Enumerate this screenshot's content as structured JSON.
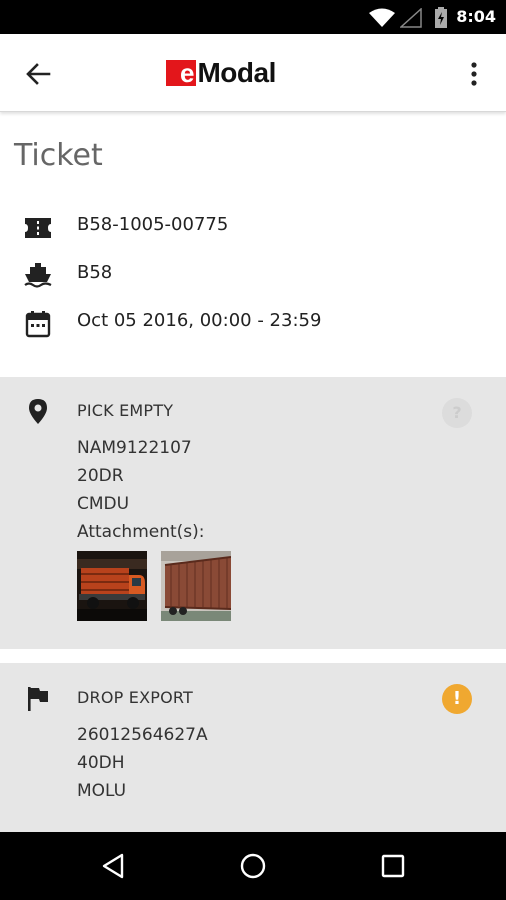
{
  "status_bar": {
    "time": "8:04"
  },
  "app_bar": {
    "logo_e": "e",
    "logo_rest": "Modal"
  },
  "page": {
    "title": "Ticket"
  },
  "ticket": {
    "number": "B58-1005-00775",
    "terminal": "B58",
    "date_range": "Oct 05 2016, 00:00 - 23:59"
  },
  "pick_card": {
    "title": "PICK EMPTY",
    "lines": [
      "NAM9122107",
      "20DR",
      "CMDU"
    ],
    "attachments_label": "Attachment(s):",
    "help_symbol": "?"
  },
  "drop_card": {
    "title": "DROP EXPORT",
    "lines": [
      "26012564627A",
      "40DH",
      "MOLU"
    ],
    "warning_symbol": "!"
  },
  "colors": {
    "brand_red": "#e3161b",
    "card_bg": "#e6e6e6",
    "warning": "#f0a830"
  }
}
